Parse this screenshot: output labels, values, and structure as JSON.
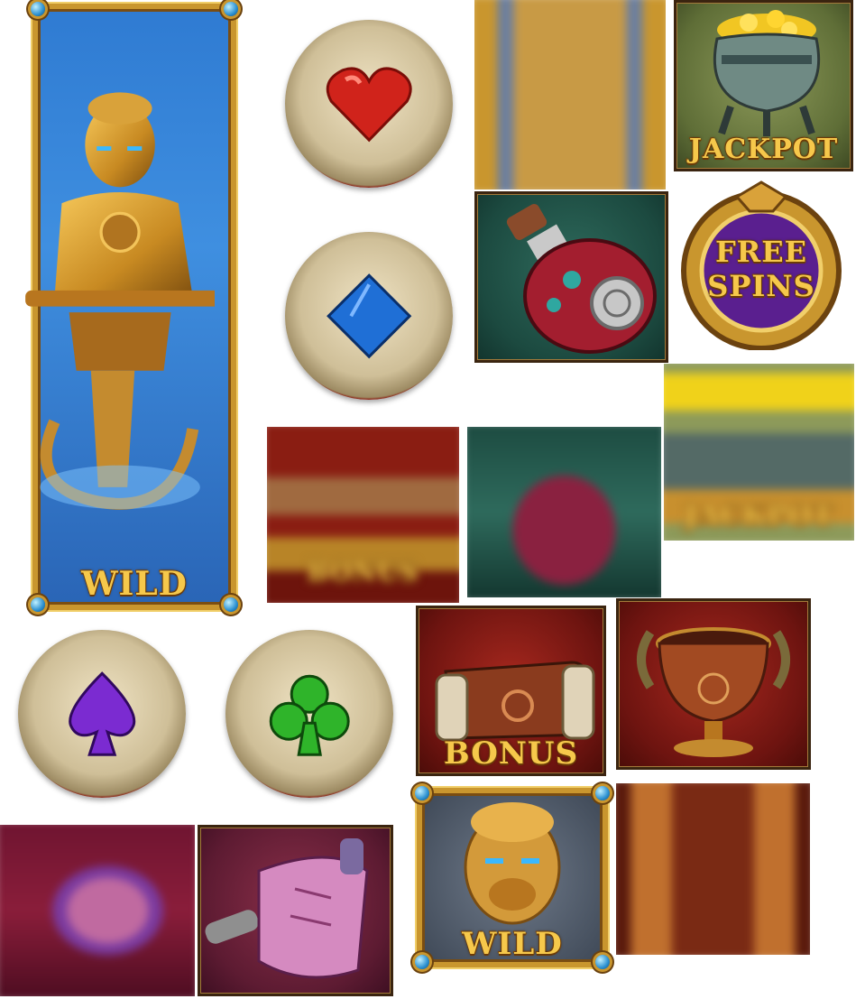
{
  "symbols": {
    "monkey_tall": {
      "label": "WILD"
    },
    "heart": {},
    "diamond": {},
    "blurred_monkey_column": {},
    "jackpot_pot": {
      "label": "JACKPOT"
    },
    "potion": {},
    "free_spins": {
      "label_line1": "FREE",
      "label_line2": "SPINS"
    },
    "blurred_jackpot": {
      "label": "JACKPOT"
    },
    "blurred_bonus": {
      "label": "BONUS"
    },
    "blurred_potion": {},
    "spade": {},
    "club": {},
    "bonus_scroll": {
      "label": "BONUS"
    },
    "goblet": {},
    "blurred_scroll": {},
    "scroll": {},
    "monkey_small": {
      "label": "WILD"
    },
    "blurred_goblet": {}
  },
  "colors": {
    "gold": "#c9962e",
    "heart_red": "#d0231b",
    "diamond_blue": "#1f6fd6",
    "spade_purple": "#7b2bd1",
    "club_green": "#2fb42a",
    "free_spins_purple": "#5a1f8f"
  }
}
